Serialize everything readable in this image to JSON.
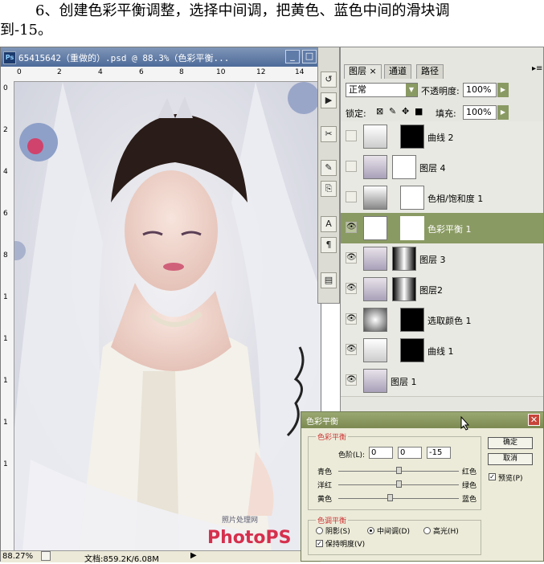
{
  "instruction": {
    "line1": "6、创建色彩平衡调整，选择中间调，把黄色、蓝色中间的滑块调",
    "line2": "到-15。"
  },
  "document": {
    "title": "65415642（重做的）.psd @ 88.3%（色彩平衡...",
    "ruler_top_ticks": [
      "0",
      "2",
      "4",
      "6",
      "8",
      "10",
      "12",
      "14"
    ],
    "ruler_left_ticks": [
      "0",
      "2",
      "4",
      "6",
      "8",
      "1",
      "1",
      "1",
      "1",
      "1"
    ],
    "watermark_cn": "照片处理网",
    "watermark_logo": "PhotoPS",
    "zoom": "88.27%",
    "doc_info": "文档:859.2K/6.08M"
  },
  "layers_panel": {
    "tabs": [
      "图层 ×",
      "通道",
      "路径"
    ],
    "blend_mode": "正常",
    "opacity_label": "不透明度:",
    "opacity_value": "100%",
    "lock_label": "锁定:",
    "fill_label": "填充:",
    "fill_value": "100%",
    "layers": [
      {
        "name": "曲线 2",
        "visible": false,
        "selected": false
      },
      {
        "name": "图层 4",
        "visible": false,
        "selected": false
      },
      {
        "name": "色相/饱和度 1",
        "visible": false,
        "selected": false
      },
      {
        "name": "色彩平衡 1",
        "visible": true,
        "selected": true
      },
      {
        "name": "图层 3",
        "visible": true,
        "selected": false
      },
      {
        "name": "图层2",
        "visible": true,
        "selected": false
      },
      {
        "name": "选取颜色 1",
        "visible": true,
        "selected": false
      },
      {
        "name": "曲线 1",
        "visible": true,
        "selected": false
      },
      {
        "name": "图层 1",
        "visible": true,
        "selected": false
      }
    ]
  },
  "color_balance": {
    "title": "色彩平衡",
    "group1": "色彩平衡",
    "levels_label": "色阶(L):",
    "levels": [
      "0",
      "0",
      "-15"
    ],
    "rows": [
      {
        "left": "青色",
        "right": "红色",
        "value": 0
      },
      {
        "left": "洋红",
        "right": "绿色",
        "value": 0
      },
      {
        "left": "黄色",
        "right": "蓝色",
        "value": -15
      }
    ],
    "ok": "确定",
    "cancel": "取消",
    "preview": "预览(P)",
    "group2": "色调平衡",
    "tones": [
      "阴影(S)",
      "中间调(D)",
      "高光(H)"
    ],
    "selected_tone": "中间调(D)",
    "preserve": "保持明度(V)"
  }
}
